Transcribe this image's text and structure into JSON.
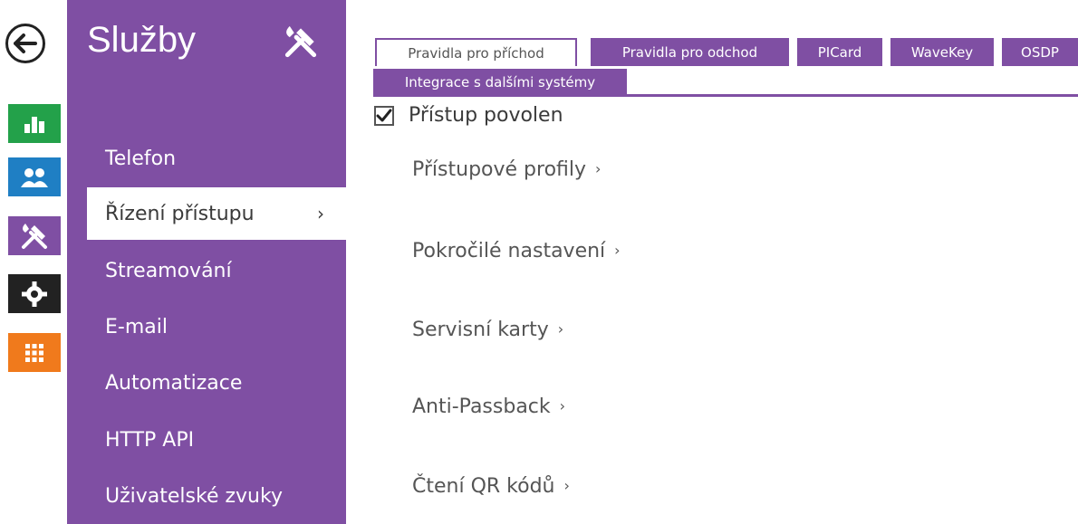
{
  "menu": {
    "title": "Služby",
    "items": [
      {
        "label": "Telefon"
      },
      {
        "label": "Řízení přístupu",
        "active": true,
        "chevron": "›"
      },
      {
        "label": "Streamování"
      },
      {
        "label": "E-mail"
      },
      {
        "label": "Automatizace"
      },
      {
        "label": "HTTP API"
      },
      {
        "label": "Uživatelské zvuky"
      }
    ]
  },
  "rail": {
    "icons": [
      "back-arrow-icon",
      "status-chart-icon",
      "directory-users-icon",
      "services-tools-icon",
      "hardware-gear-icon",
      "system-grid-icon"
    ],
    "colors": {
      "status": "#23a14a",
      "directory": "#1f7fc4",
      "services": "#7f4fa3",
      "hardware": "#222222",
      "system": "#f07a1c"
    }
  },
  "tabs": [
    {
      "label": "Pravidla pro příchod",
      "active": true
    },
    {
      "label": "Pravidla pro odchod"
    },
    {
      "label": "PICard"
    },
    {
      "label": "WaveKey"
    },
    {
      "label": "OSDP"
    },
    {
      "label": "Integrace s dalšími systémy"
    }
  ],
  "content": {
    "access_enabled": {
      "label": "Přístup povolen",
      "checked": true
    },
    "links": [
      {
        "label": "Přístupové profily",
        "arrow": "›"
      },
      {
        "label": "Pokročilé nastavení",
        "arrow": "›"
      },
      {
        "label": "Servisní karty",
        "arrow": "›"
      },
      {
        "label": "Anti-Passback",
        "arrow": "›"
      },
      {
        "label": "Čtení QR kódů",
        "arrow": "›"
      }
    ]
  },
  "accent_color": "#7f4fa3"
}
